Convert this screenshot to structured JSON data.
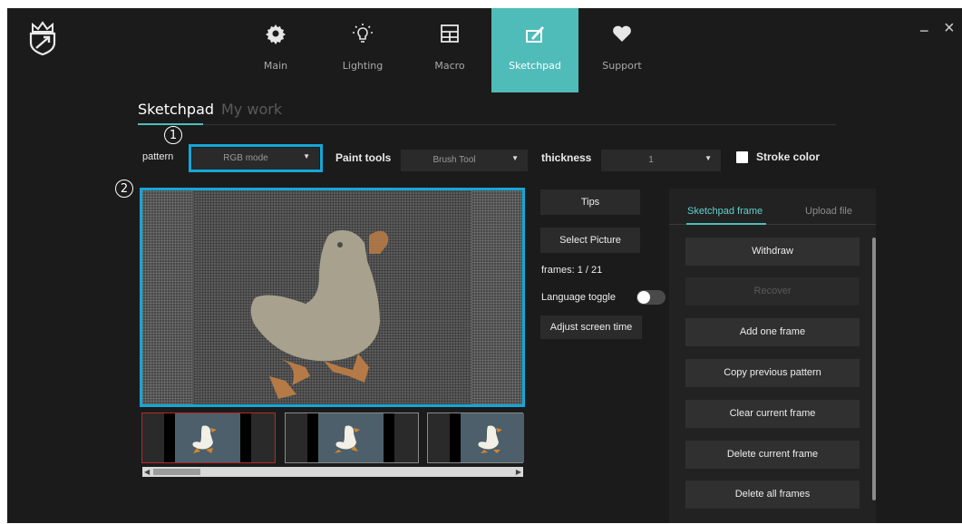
{
  "nav": {
    "items": [
      {
        "label": "Main",
        "icon": "gear-icon"
      },
      {
        "label": "Lighting",
        "icon": "lightbulb-icon"
      },
      {
        "label": "Macro",
        "icon": "grid-icon"
      },
      {
        "label": "Sketchpad",
        "icon": "sketch-icon"
      },
      {
        "label": "Support",
        "icon": "heart-icon"
      }
    ],
    "active": "Sketchpad"
  },
  "window": {
    "minimize": "−",
    "close": "×"
  },
  "subtabs": {
    "active": "Sketchpad",
    "inactive": "My work"
  },
  "toolbar": {
    "pattern_label": "pattern",
    "pattern_value": "RGB mode",
    "paint_tools_label": "Paint tools",
    "paint_tools_value": "Brush Tool",
    "thickness_label": "thickness",
    "thickness_value": "1",
    "stroke_color_label": "Stroke color",
    "dropdown_arrow": "▼"
  },
  "annotations": {
    "one": "1",
    "two": "2"
  },
  "controls": {
    "tips": "Tips",
    "select_picture": "Select Picture",
    "frames": "frames: 1 / 21",
    "language_toggle": "Language toggle",
    "adjust_screen_time": "Adjust screen time"
  },
  "panel": {
    "tab_active": "Sketchpad frame",
    "tab_inactive": "Upload file",
    "buttons": {
      "withdraw": "Withdraw",
      "recover": "Recover",
      "add_one_frame": "Add one frame",
      "copy_previous_pattern": "Copy previous pattern",
      "clear_current_frame": "Clear current frame",
      "delete_current_frame": "Delete current frame",
      "delete_all_frames": "Delete all frames"
    }
  },
  "scroll": {
    "left": "◀",
    "right": "▶"
  },
  "colors": {
    "accent": "#4fbcb9",
    "highlight": "#14a7d8",
    "duck_body": "#a7a18e",
    "duck_orange": "#b57a46"
  }
}
